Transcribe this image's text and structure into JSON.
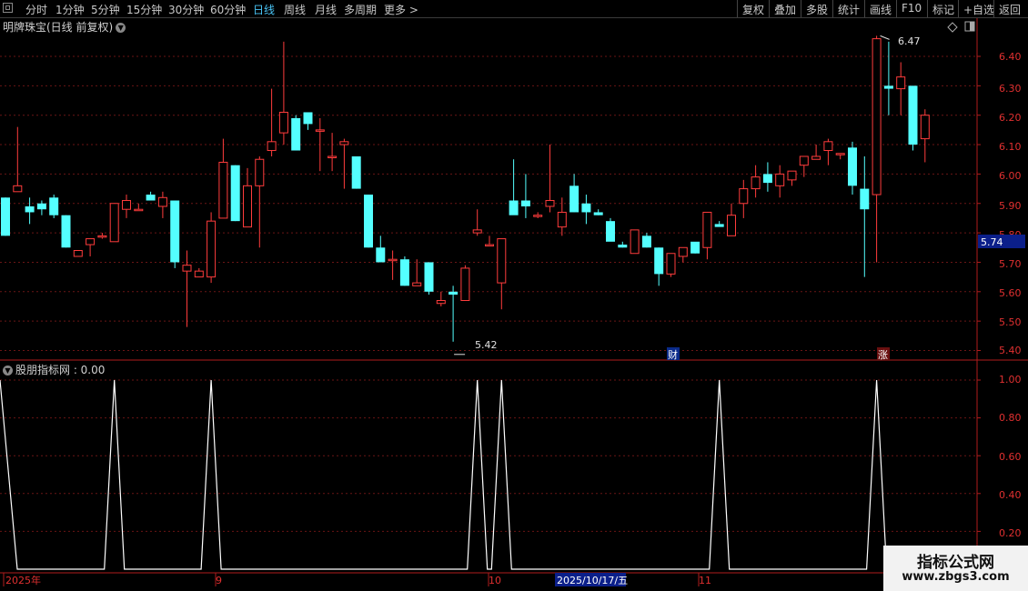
{
  "toolbar": {
    "periods": [
      "分时",
      "1分钟",
      "5分钟",
      "15分钟",
      "30分钟",
      "60分钟",
      "日线",
      "周线",
      "月线",
      "多周期",
      "更多 >"
    ],
    "active_period": "日线",
    "right_buttons": [
      "复权",
      "叠加",
      "多股",
      "统计",
      "画线",
      "F10",
      "标记",
      "+自选",
      "返回"
    ]
  },
  "chart": {
    "title": "明牌珠宝(日线 前复权)",
    "price_ticks": [
      "6.40",
      "6.30",
      "6.20",
      "6.10",
      "6.00",
      "5.90",
      "5.80",
      "5.70",
      "5.60",
      "5.50",
      "5.40"
    ],
    "price_label": "5.74",
    "high_marker": "6.47",
    "low_marker": "5.42",
    "badge_cai": "财",
    "badge_zhang": "涨",
    "colors": {
      "up": "#ff3c3c",
      "down": "#54ffff",
      "bg": "#000000",
      "grid": "#6a1515",
      "axis": "#b01c1c",
      "tick_text": "#e03030"
    }
  },
  "indicator": {
    "title": "股朋指标网 : 0.00",
    "ticks": [
      "1.00",
      "0.80",
      "0.60",
      "0.40",
      "0.20"
    ],
    "line_color": "#ffffff"
  },
  "date_axis": {
    "labels": [
      "2025年",
      "9",
      "10",
      "2025/10/17/五",
      "11"
    ]
  },
  "watermark": {
    "line1": "指标公式网",
    "line2": "www.zbgs3.com"
  },
  "chart_data": {
    "type": "candlestick",
    "ylim": [
      5.37,
      6.49
    ],
    "candles": [
      [
        5.92,
        5.92,
        5.79,
        5.79
      ],
      [
        5.94,
        6.16,
        5.94,
        5.96
      ],
      [
        5.89,
        5.92,
        5.83,
        5.87
      ],
      [
        5.9,
        5.91,
        5.86,
        5.88
      ],
      [
        5.92,
        5.93,
        5.85,
        5.86
      ],
      [
        5.86,
        5.86,
        5.75,
        5.75
      ],
      [
        5.72,
        5.74,
        5.72,
        5.74
      ],
      [
        5.76,
        5.77,
        5.72,
        5.78
      ],
      [
        5.79,
        5.8,
        5.78,
        5.79
      ],
      [
        5.77,
        5.9,
        5.77,
        5.9
      ],
      [
        5.88,
        5.93,
        5.85,
        5.91
      ],
      [
        5.88,
        5.9,
        5.88,
        5.88
      ],
      [
        5.93,
        5.94,
        5.91,
        5.91
      ],
      [
        5.89,
        5.94,
        5.85,
        5.92
      ],
      [
        5.91,
        5.91,
        5.68,
        5.7
      ],
      [
        5.67,
        5.74,
        5.48,
        5.69
      ],
      [
        5.65,
        5.68,
        5.65,
        5.67
      ],
      [
        5.65,
        5.87,
        5.63,
        5.84
      ],
      [
        5.85,
        6.12,
        5.85,
        6.04
      ],
      [
        6.03,
        6.03,
        5.84,
        5.84
      ],
      [
        5.82,
        6.02,
        5.82,
        5.96
      ],
      [
        5.96,
        6.06,
        5.75,
        6.05
      ],
      [
        6.08,
        6.29,
        6.06,
        6.11
      ],
      [
        6.14,
        6.45,
        6.1,
        6.21
      ],
      [
        6.19,
        6.2,
        6.08,
        6.08
      ],
      [
        6.21,
        6.21,
        6.15,
        6.17
      ],
      [
        6.15,
        6.19,
        6.01,
        6.15
      ],
      [
        6.06,
        6.14,
        6.01,
        6.06
      ],
      [
        6.1,
        6.12,
        5.95,
        6.11
      ],
      [
        6.06,
        6.06,
        5.95,
        5.95
      ],
      [
        5.93,
        5.93,
        5.75,
        5.75
      ],
      [
        5.75,
        5.79,
        5.7,
        5.7
      ],
      [
        5.71,
        5.74,
        5.64,
        5.71
      ],
      [
        5.71,
        5.72,
        5.62,
        5.62
      ],
      [
        5.62,
        5.71,
        5.62,
        5.63
      ],
      [
        5.7,
        5.7,
        5.59,
        5.6
      ],
      [
        5.56,
        5.6,
        5.55,
        5.57
      ],
      [
        5.6,
        5.62,
        5.43,
        5.59
      ],
      [
        5.57,
        5.69,
        5.57,
        5.68
      ],
      [
        5.8,
        5.88,
        5.79,
        5.81
      ],
      [
        5.76,
        5.79,
        5.76,
        5.76
      ],
      [
        5.63,
        5.65,
        5.54,
        5.78
      ],
      [
        5.91,
        6.05,
        5.87,
        5.86
      ],
      [
        5.91,
        6.0,
        5.85,
        5.89
      ],
      [
        5.86,
        5.87,
        5.85,
        5.86
      ],
      [
        5.89,
        6.1,
        5.87,
        5.91
      ],
      [
        5.82,
        5.92,
        5.79,
        5.87
      ],
      [
        5.96,
        6.0,
        5.87,
        5.87
      ],
      [
        5.9,
        5.93,
        5.83,
        5.87
      ],
      [
        5.87,
        5.88,
        5.86,
        5.86
      ],
      [
        5.84,
        5.85,
        5.79,
        5.77
      ],
      [
        5.76,
        5.77,
        5.75,
        5.75
      ],
      [
        5.73,
        5.8,
        5.73,
        5.81
      ],
      [
        5.79,
        5.8,
        5.75,
        5.75
      ],
      [
        5.75,
        5.75,
        5.62,
        5.66
      ],
      [
        5.66,
        5.72,
        5.65,
        5.73
      ],
      [
        5.72,
        5.74,
        5.7,
        5.75
      ],
      [
        5.77,
        5.74,
        5.73,
        5.73
      ],
      [
        5.75,
        5.87,
        5.71,
        5.87
      ],
      [
        5.83,
        5.84,
        5.83,
        5.82
      ],
      [
        5.79,
        5.9,
        5.79,
        5.86
      ],
      [
        5.9,
        5.98,
        5.85,
        5.95
      ],
      [
        5.95,
        6.03,
        5.92,
        5.99
      ],
      [
        6.0,
        6.04,
        5.94,
        5.97
      ],
      [
        5.96,
        6.03,
        5.92,
        6.0
      ],
      [
        5.98,
        6.0,
        5.96,
        6.01
      ],
      [
        6.03,
        6.04,
        5.99,
        6.06
      ],
      [
        6.05,
        6.1,
        6.05,
        6.06
      ],
      [
        6.08,
        6.12,
        6.03,
        6.11
      ],
      [
        6.07,
        6.07,
        6.05,
        6.07
      ],
      [
        6.09,
        6.11,
        5.93,
        5.96
      ],
      [
        5.95,
        6.06,
        5.65,
        5.88
      ],
      [
        5.93,
        6.47,
        5.7,
        6.46
      ],
      [
        6.3,
        6.45,
        6.2,
        6.29
      ],
      [
        6.29,
        6.38,
        6.2,
        6.33
      ],
      [
        6.3,
        6.3,
        6.08,
        6.1
      ],
      [
        6.12,
        6.22,
        6.04,
        6.2
      ]
    ],
    "indicator_peaks_candle_index": [
      0,
      9,
      17,
      39,
      41,
      59,
      72
    ]
  }
}
